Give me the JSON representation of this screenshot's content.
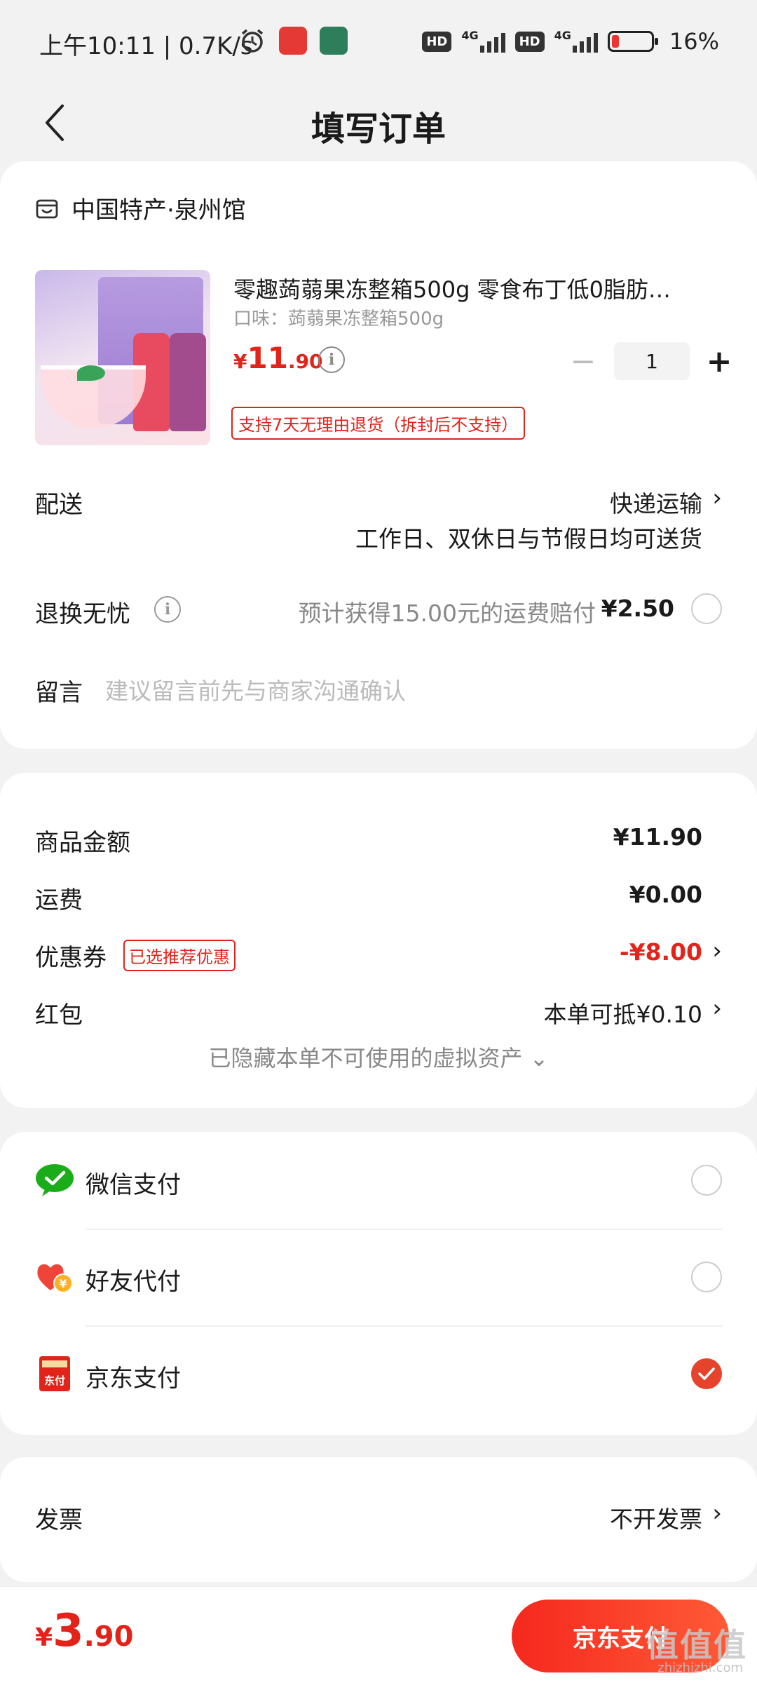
{
  "status_bar": {
    "time": "上午10:11 | 0.7K/s",
    "network_badge": "HD",
    "network_type": "4G",
    "battery": "16%"
  },
  "header": {
    "title": "填写订单"
  },
  "shop": {
    "name": "中国特产·泉州馆",
    "icon": "shop-icon"
  },
  "product": {
    "title": "零趣蒟蒻果冻整箱500g 零食布丁低0脂肪…",
    "spec": "口味：蒟蒻果冻整箱500g",
    "price_currency": "¥",
    "price_int": "11",
    "price_dec": ".90",
    "quantity": "1",
    "minus": "−",
    "plus": "+",
    "return_tag": "支持7天无理由退货（拆封后不支持）"
  },
  "delivery": {
    "label": "配送",
    "method": "快递运输",
    "note": "工作日、双休日与节假日均可送货"
  },
  "insurance": {
    "label": "退换无忧",
    "desc": "预计获得15.00元的运费赔付",
    "price": "¥2.50"
  },
  "message": {
    "label": "留言",
    "placeholder": "建议留言前先与商家沟通确认"
  },
  "amounts": {
    "goods_label": "商品金额",
    "goods_value": "¥11.90",
    "shipping_label": "运费",
    "shipping_value": "¥0.00",
    "coupon_label": "优惠券",
    "coupon_tag": "已选推荐优惠",
    "coupon_value": "-¥8.00",
    "redpacket_label": "红包",
    "redpacket_value": "本单可抵¥0.10",
    "hidden_note": "已隐藏本单不可使用的虚拟资产 ⌄"
  },
  "payment": {
    "wechat": "微信支付",
    "friend": "好友代付",
    "jd": "京东支付",
    "selected": "jd"
  },
  "invoice": {
    "label": "发票",
    "value": "不开发票"
  },
  "footer": {
    "total_currency": "¥",
    "total_int": "3",
    "total_dec": ".90",
    "pay_button": "京东支付"
  },
  "watermark": {
    "main": "值值值",
    "sub": "zhizhizhi.com"
  },
  "colors": {
    "accent": "#e2231a",
    "button": "#f5281e",
    "check": "#e5432b",
    "wechat": "#1aad19"
  },
  "chev": "›"
}
